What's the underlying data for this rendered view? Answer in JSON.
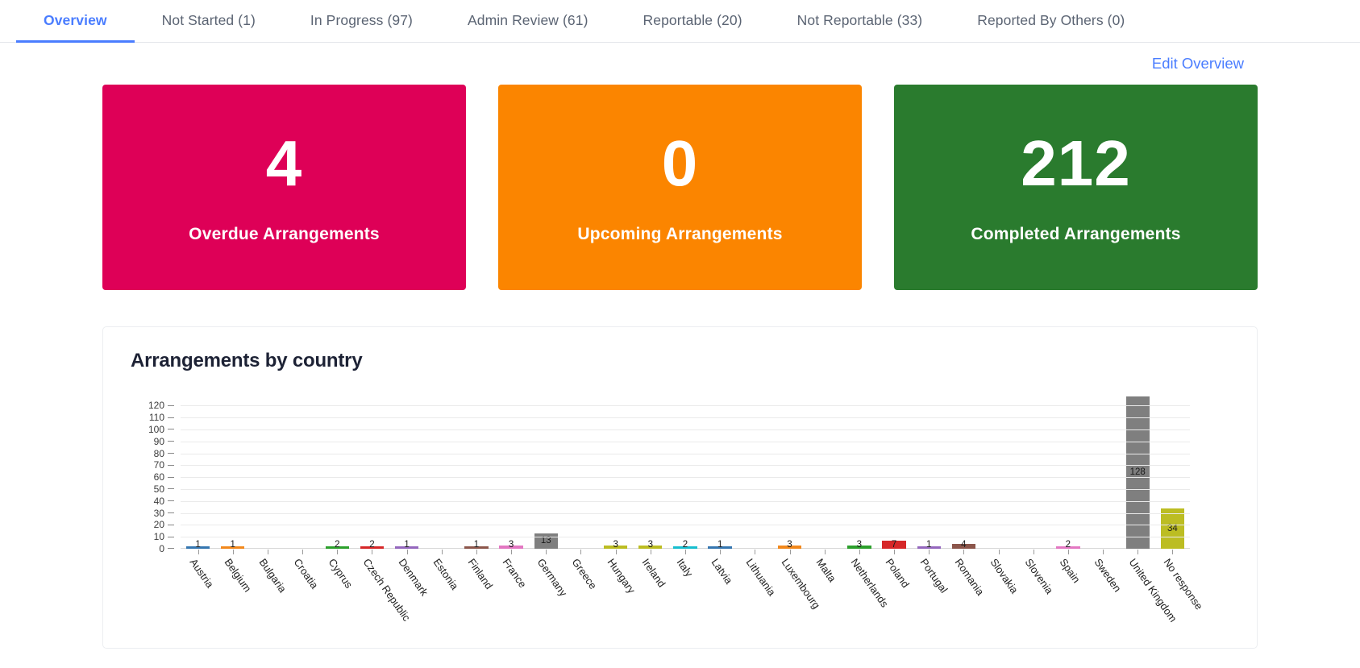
{
  "tabs": [
    {
      "label": "Overview",
      "active": true
    },
    {
      "label": "Not Started (1)",
      "active": false
    },
    {
      "label": "In Progress (97)",
      "active": false
    },
    {
      "label": "Admin Review (61)",
      "active": false
    },
    {
      "label": "Reportable (20)",
      "active": false
    },
    {
      "label": "Not Reportable (33)",
      "active": false
    },
    {
      "label": "Reported By Others (0)",
      "active": false
    }
  ],
  "actions": {
    "edit_overview": "Edit Overview"
  },
  "cards": [
    {
      "value": "4",
      "label": "Overdue Arrangements",
      "color": "#DE0057"
    },
    {
      "value": "0",
      "label": "Upcoming Arrangements",
      "color": "#FB8500"
    },
    {
      "value": "212",
      "label": "Completed Arrangements",
      "color": "#2A7B2E"
    }
  ],
  "chart_data": {
    "type": "bar",
    "title": "Arrangements by country",
    "xlabel": "",
    "ylabel": "",
    "ylim": [
      0,
      125
    ],
    "yticks": [
      0,
      10,
      20,
      30,
      40,
      50,
      60,
      70,
      80,
      90,
      100,
      110,
      120
    ],
    "grid": true,
    "legend": false,
    "categories": [
      "Austria",
      "Belgium",
      "Bulgaria",
      "Croatia",
      "Cyprus",
      "Czech Republic",
      "Denmark",
      "Estonia",
      "Finland",
      "France",
      "Germany",
      "Greece",
      "Hungary",
      "Ireland",
      "Italy",
      "Latvia",
      "Lithuania",
      "Luxembourg",
      "Malta",
      "Netherlands",
      "Poland",
      "Portugal",
      "Romania",
      "Slovakia",
      "Slovenia",
      "Spain",
      "Sweden",
      "United Kingdom",
      "No response"
    ],
    "values": [
      1,
      1,
      0,
      0,
      2,
      2,
      1,
      0,
      1,
      3,
      13,
      0,
      3,
      3,
      2,
      1,
      0,
      3,
      0,
      3,
      7,
      1,
      4,
      0,
      0,
      2,
      0,
      128,
      34
    ],
    "colors": [
      "#3576B0",
      "#F2881C",
      "#2CA02C",
      "#D62728",
      "#2CA02C",
      "#D62728",
      "#9467BD",
      "#8C564B",
      "#8C564B",
      "#E377C2",
      "#7F7F7F",
      "#BCBD22",
      "#BCBD22",
      "#BCBD22",
      "#17BECF",
      "#3576B0",
      "#F2881C",
      "#F2881C",
      "#2CA02C",
      "#2CA02C",
      "#D62728",
      "#9467BD",
      "#8C564B",
      "#8C564B",
      "#E377C2",
      "#E377C2",
      "#7F7F7F",
      "#7F7F7F",
      "#BCBD22"
    ]
  }
}
